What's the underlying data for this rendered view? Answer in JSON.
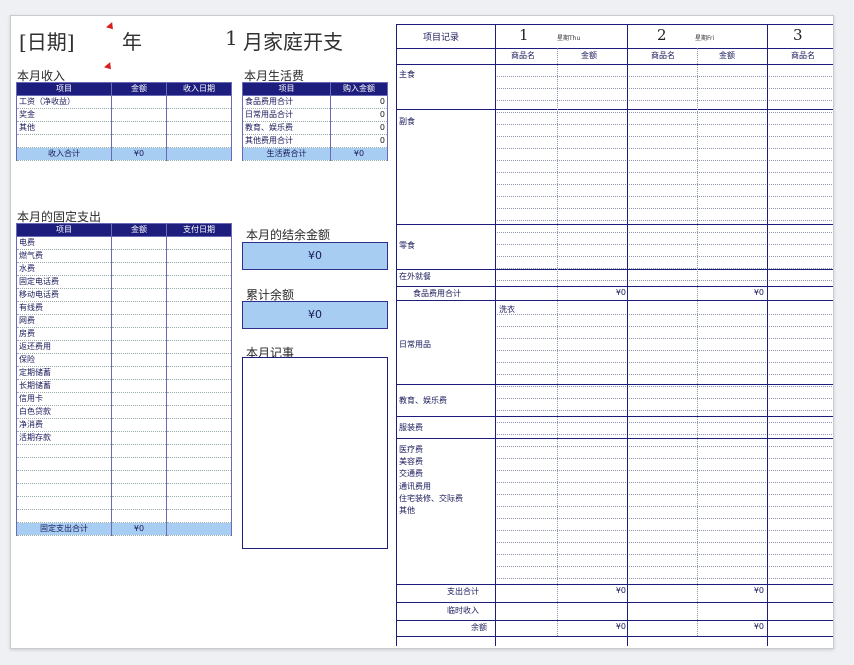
{
  "header": {
    "date_label": "[日期]",
    "year_label": "年",
    "month_number": "1",
    "month_title": "月家庭开支"
  },
  "income": {
    "section_label": "本月收入",
    "columns": [
      "项目",
      "金额",
      "收入日期"
    ],
    "rows": [
      [
        "工资（净收益）",
        "",
        ""
      ],
      [
        "奖金",
        "",
        ""
      ],
      [
        "其他",
        "",
        ""
      ],
      [
        "",
        "",
        ""
      ]
    ],
    "total_label": "收入合计",
    "total_value": "¥0"
  },
  "living": {
    "section_label": "本月生活费",
    "columns": [
      "项目",
      "购入金额"
    ],
    "rows": [
      [
        "食品费用合计",
        "0"
      ],
      [
        "日常用品合计",
        "0"
      ],
      [
        "教育、娱乐费",
        "0"
      ],
      [
        "其他费用合计",
        "0"
      ]
    ],
    "total_label": "生活费合计",
    "total_value": "¥0"
  },
  "fixed": {
    "section_label": "本月的固定支出",
    "columns": [
      "项目",
      "金额",
      "支付日期"
    ],
    "rows": [
      "电费",
      "燃气费",
      "水费",
      "固定电话费",
      "移动电话费",
      "有线费",
      "网费",
      "房费",
      "返还费用",
      "保险",
      "定期储蓄",
      "长期储蓄",
      "信用卡",
      "白色贷款",
      "净消费",
      "活期存款",
      "",
      "",
      "",
      "",
      "",
      ""
    ],
    "total_label": "固定支出合计",
    "total_value": "¥0"
  },
  "balance": {
    "label": "本月的结余金额",
    "value": "¥0"
  },
  "cumulative": {
    "label": "累计余额",
    "value": "¥0"
  },
  "memo": {
    "label": "本月记事"
  },
  "ledger": {
    "header_label": "项目记录",
    "days": [
      {
        "num": "1",
        "weekday": "星期Thu"
      },
      {
        "num": "2",
        "weekday": "星期Fri"
      },
      {
        "num": "3",
        "weekday": ""
      }
    ],
    "subcolumns": [
      "商品名",
      "金额",
      "商品名",
      "金额",
      "商品名"
    ],
    "groups": [
      "主食",
      "副食",
      "零食",
      "在外就餐"
    ],
    "food_total_label": "食品费用合计",
    "food_total_values": [
      "¥0",
      "¥0"
    ],
    "daily_groups": [
      "日常用品",
      "教育、娱乐费",
      "服装费",
      "医疗费",
      "美容费",
      "交通费",
      "通讯费用",
      "住宅装修、交际费",
      "其他"
    ],
    "daily_note": "洗衣",
    "expense_total_label": "支出合计",
    "expense_total_values": [
      "¥0",
      "¥0"
    ],
    "temp_income_label": "临时收入",
    "balance_label": "余额",
    "balance_values": [
      "¥0",
      "¥0"
    ]
  }
}
